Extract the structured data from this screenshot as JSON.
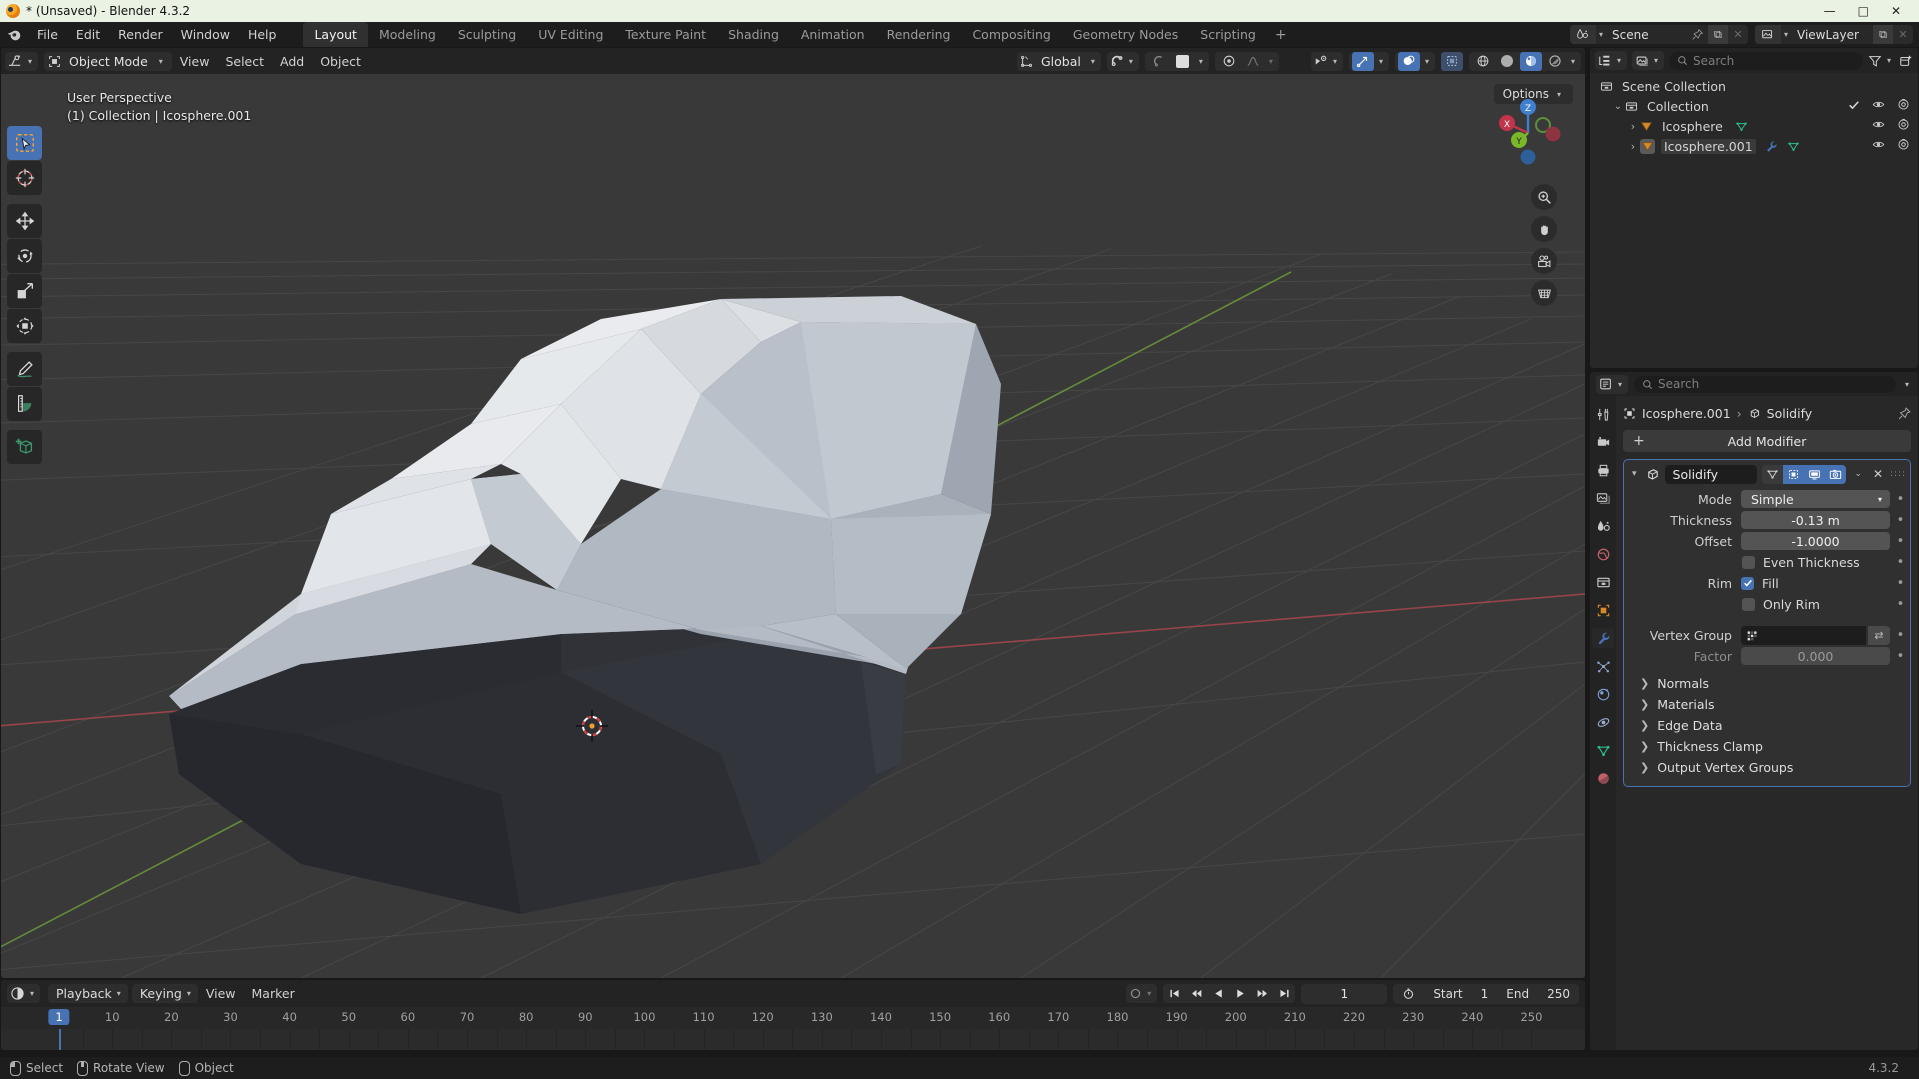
{
  "window": {
    "title": "* (Unsaved) - Blender 4.3.2",
    "minimize": "—",
    "maximize": "□",
    "close": "✕"
  },
  "topbar": {
    "menus": [
      "File",
      "Edit",
      "Render",
      "Window",
      "Help"
    ],
    "tabs": [
      "Layout",
      "Modeling",
      "Sculpting",
      "UV Editing",
      "Texture Paint",
      "Shading",
      "Animation",
      "Rendering",
      "Compositing",
      "Geometry Nodes",
      "Scripting"
    ],
    "active_tab": "Layout",
    "add_tab": "+",
    "scene": {
      "name": "Scene",
      "new_btn": "⧉",
      "unlink_btn": "✕"
    },
    "viewlayer": {
      "name": "ViewLayer",
      "new_btn": "⧉",
      "unlink_btn": "✕"
    }
  },
  "viewport": {
    "header": {
      "mode": "Object Mode",
      "menus": [
        "View",
        "Select",
        "Add",
        "Object"
      ],
      "transform_orientation": "Global",
      "chevron": "⌄"
    },
    "options_label": "Options",
    "overlay": {
      "line1": "User Perspective",
      "line2": "(1) Collection | Icosphere.001"
    },
    "gizmo_axes": [
      "X",
      "Y",
      "Z"
    ],
    "tools": [
      "tweak-select-tool",
      "cursor-tool",
      "move-tool",
      "rotate-tool",
      "scale-tool",
      "transform-tool",
      "annotate-tool",
      "measure-tool",
      "add-cube-tool"
    ],
    "nav_buttons": [
      "zoom-navigate",
      "pan-navigate",
      "camera-view",
      "toggle-orthographic"
    ],
    "colors": {
      "background": "#393939",
      "grid_line": "#4a4a4a",
      "axis_x": "#a8474f",
      "axis_y": "#6e9a3b",
      "mesh_light": "#c7ccd3",
      "mesh_dark": "#2b2d33",
      "accent": "#4772b3"
    }
  },
  "timeline": {
    "editor_icon": "clock-icon",
    "menus": [
      "Playback",
      "Keying",
      "View",
      "Marker"
    ],
    "current_frame": "1",
    "start_label": "Start",
    "start_value": "1",
    "end_label": "End",
    "end_value": "250",
    "ticks": [
      "1",
      "10",
      "20",
      "30",
      "40",
      "50",
      "60",
      "70",
      "80",
      "90",
      "100",
      "110",
      "120",
      "130",
      "140",
      "150",
      "160",
      "170",
      "180",
      "190",
      "200",
      "210",
      "220",
      "230",
      "240",
      "250"
    ],
    "playhead_frame": "1",
    "transport": [
      "jump-to-start",
      "prev-keyframe",
      "play-reverse",
      "play",
      "next-keyframe",
      "jump-to-end"
    ]
  },
  "outliner": {
    "search_placeholder": "Search",
    "display_mode_icon": "view-layer-icon",
    "filter_icon": "filter-icon",
    "new_collection_icon": "new-collection-icon",
    "rows": [
      {
        "label": "Scene Collection",
        "indent": 0,
        "icon": "collection-icon",
        "expander": "",
        "selected": false,
        "has_vis": false,
        "extras": []
      },
      {
        "label": "Collection",
        "indent": 1,
        "icon": "collection-icon",
        "expander": "⌄",
        "selected": false,
        "has_vis": true,
        "checkbox": true,
        "extras": []
      },
      {
        "label": "Icosphere",
        "indent": 2,
        "icon": "mesh-triangle-icon",
        "expander": "›",
        "selected": false,
        "has_vis": true,
        "extras": [
          "mesh-data-icon"
        ]
      },
      {
        "label": "Icosphere.001",
        "indent": 2,
        "icon": "mesh-triangle-icon",
        "expander": "›",
        "selected": true,
        "has_vis": true,
        "extras": [
          "wrench-modifier-icon",
          "mesh-data-icon"
        ]
      }
    ]
  },
  "properties": {
    "search_placeholder": "Search",
    "editor_icon": "properties-editor-icon",
    "tabs": [
      "tool-icon",
      "render-icon",
      "output-icon",
      "view-layer-icon",
      "scene-icon",
      "world-icon",
      "collection-icon",
      "object-icon",
      "modifier-icon",
      "particles-icon",
      "physics-icon",
      "constraints-icon",
      "data-icon",
      "material-icon"
    ],
    "active_tab": "modifier-icon",
    "breadcrumb": {
      "object": "Icosphere.001",
      "separator": "›",
      "modifier": "Solidify",
      "pin_icon": "pin-icon"
    },
    "add_modifier_label": "Add Modifier",
    "modifier": {
      "name": "Solidify",
      "expanded": true,
      "toggles": [
        {
          "name": "on-cage",
          "active": false
        },
        {
          "name": "edit-mode",
          "active": true
        },
        {
          "name": "realtime",
          "active": true
        },
        {
          "name": "render",
          "active": true
        }
      ],
      "extras_icon": "⌄",
      "close_icon": "✕",
      "fields": [
        {
          "type": "dropdown",
          "label": "Mode",
          "value": "Simple"
        },
        {
          "type": "number",
          "label": "Thickness",
          "value": "-0.13 m"
        },
        {
          "type": "number",
          "label": "Offset",
          "value": "-1.0000"
        },
        {
          "type": "checkbox",
          "label": "Even Thickness",
          "checked": false
        },
        {
          "type": "checkbox",
          "label": "Fill",
          "group": "Rim",
          "checked": true
        },
        {
          "type": "checkbox",
          "label": "Only Rim",
          "checked": false
        },
        {
          "type": "vertexgroup",
          "label": "Vertex Group",
          "value": ""
        },
        {
          "type": "number-disabled",
          "label": "Factor",
          "value": "0.000"
        }
      ],
      "sections": [
        "Normals",
        "Materials",
        "Edge Data",
        "Thickness Clamp",
        "Output Vertex Groups"
      ]
    }
  },
  "statusbar": {
    "items": [
      {
        "icon": "mouse-left-icon",
        "label": "Select"
      },
      {
        "icon": "mouse-middle-icon",
        "label": "Rotate View"
      },
      {
        "icon": "mouse-right-icon",
        "label": "Object"
      }
    ],
    "version": "4.3.2"
  }
}
